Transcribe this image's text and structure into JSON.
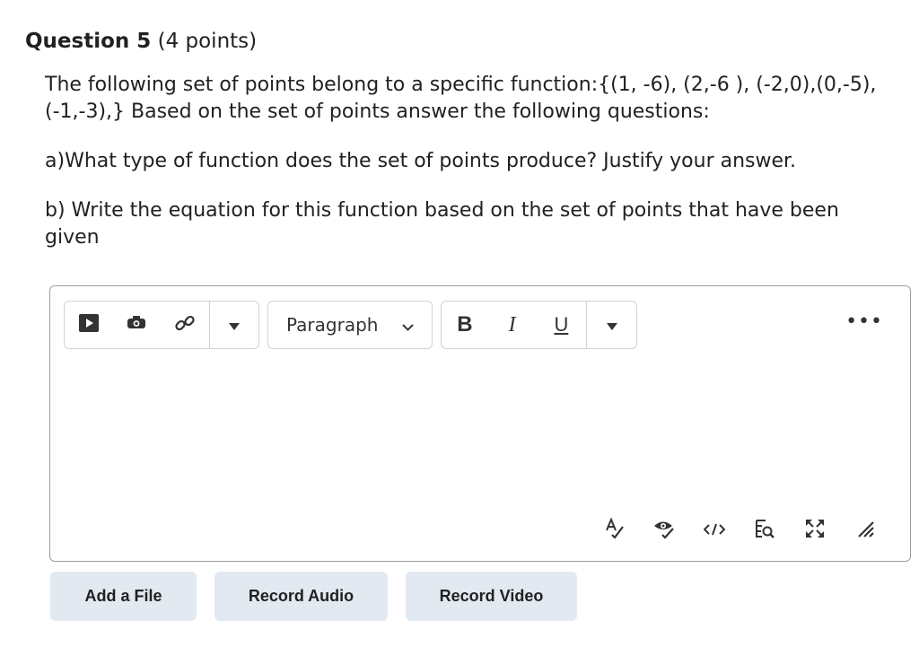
{
  "question": {
    "title_bold": "Question 5",
    "title_points": " (4 points)",
    "body_line1": "The following set of points belong to a specific function:{(1, -6), (2,-6 ), (-2,0),(0,-5), (-1,-3),}  Based on the set of points answer the following questions:",
    "part_a": "a)What type of function does the set of points produce?  Justify your answer.",
    "part_b": "b) Write the equation for this function based on the set of points that have been given"
  },
  "editor": {
    "paragraph_label": "Paragraph",
    "bold_label": "B",
    "italic_label": "I",
    "underline_label": "U",
    "more_label": "•••",
    "content": "",
    "toolbar_icons": [
      "insert-stuff-icon",
      "equation-icon",
      "insert-link-icon",
      "dropdown-icon"
    ],
    "bottom_icons": [
      "spellcheck-icon",
      "accessibility-check-icon",
      "source-code-icon",
      "preview-icon",
      "fullscreen-icon",
      "resize-handle-icon"
    ]
  },
  "actions": {
    "add_file": "Add a File",
    "record_audio": "Record Audio",
    "record_video": "Record Video"
  }
}
